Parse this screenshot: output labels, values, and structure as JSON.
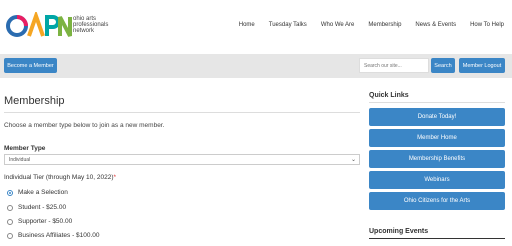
{
  "brand": {
    "logo_text": "OAPN",
    "tagline_lines": [
      "ohio arts",
      "professionals",
      "network"
    ]
  },
  "nav": {
    "items": [
      "Home",
      "Tuesday Talks",
      "Who We Are",
      "Membership",
      "News & Events",
      "How To Help"
    ]
  },
  "toolbar": {
    "become_member": "Become a Member",
    "search_placeholder": "Search our site...",
    "search_button": "Search",
    "logout_button": "Member Logout"
  },
  "main": {
    "title": "Membership",
    "intro": "Choose a member type below to join as a new member.",
    "member_type_label": "Member Type",
    "member_type_value": "Individual",
    "tier_label": "Individual Tier (through May 10, 2022)",
    "required_mark": "*",
    "options": [
      {
        "label": "Make a Selection",
        "checked": true
      },
      {
        "label": "Student - $25.00",
        "checked": false
      },
      {
        "label": "Supporter - $50.00",
        "checked": false
      },
      {
        "label": "Business Affiliates - $100.00",
        "checked": false
      }
    ]
  },
  "sidebar": {
    "title": "Quick Links",
    "links": [
      "Donate Today!",
      "Member Home",
      "Membership Benefits",
      "Webinars",
      "Ohio Citizens for the Arts"
    ],
    "events_title": "Upcoming Events"
  },
  "colors": {
    "accent": "#3b86c6",
    "toolbar_bg": "#e6e6e6"
  }
}
